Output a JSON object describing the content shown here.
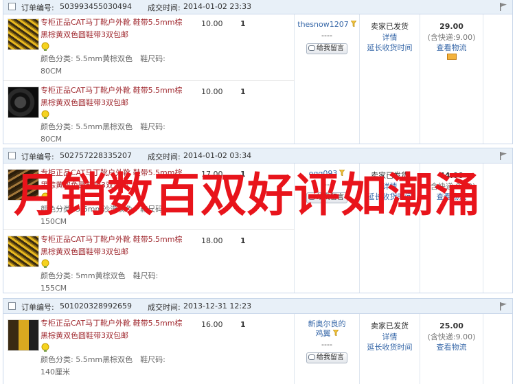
{
  "orders": [
    {
      "id_label": "订单编号:",
      "id": "503993455030494",
      "time_label": "成交时间:",
      "time": "2014-01-02 23:33",
      "items": [
        {
          "title": "专柜正品CAT马丁靴户外靴 鞋带5.5mm棕黑棕黄双色圆鞋带3双包邮",
          "attr": "颜色分类: 5.5mm黄棕双色　鞋尺码: 80CM",
          "price": "10.00",
          "qty": "1",
          "thumb": "rope-gold"
        },
        {
          "title": "专柜正品CAT马丁靴户外靴 鞋带5.5mm棕黑棕黄双色圆鞋带3双包邮",
          "attr": "颜色分类: 5.5mm黑棕双色　鞋尺码: 80CM",
          "price": "10.00",
          "qty": "1",
          "thumb": "rope-black"
        }
      ],
      "buyer": "thesnow1207",
      "buyer_dash": "----",
      "msg_button": "给我留言",
      "status": "卖家已发货",
      "details": "详情",
      "extend": "延长收货时间",
      "total": "29.00",
      "shipping": "(含快递:9.00)",
      "logistics": "查看物流"
    },
    {
      "id_label": "订单编号:",
      "id": "502757228335207",
      "time_label": "成交时间:",
      "time": "2014-01-02 03:34",
      "items": [
        {
          "title": "专柜正品CAT马丁靴户外靴 鞋带5.5mm棕黑棕黄双色圆鞋带3双包邮",
          "attr": "颜色分类: 5.5mm沙漠灰色　鞋尺码: 150CM",
          "price": "17.00",
          "qty": "1",
          "thumb": "rope-dark"
        },
        {
          "title": "专柜正品CAT马丁靴户外靴 鞋带5.5mm棕黑棕黄双色圆鞋带3双包邮",
          "attr": "颜色分类: 5mm黄棕双色　鞋尺码: 155CM",
          "price": "18.00",
          "qty": "1",
          "thumb": "rope-gold"
        }
      ],
      "buyer": "oqq093",
      "buyer_dash": "----",
      "msg_button": "给我留言",
      "status": "卖家已发货",
      "details": "详情",
      "extend": "延长收货时间",
      "total": "44.00",
      "shipping": "(含快递:9.00)",
      "logistics": "查看物流"
    },
    {
      "id_label": "订单编号:",
      "id": "501020328992659",
      "time_label": "成交时间:",
      "time": "2013-12-31 12:23",
      "items": [
        {
          "title": "专柜正品CAT马丁靴户外靴 鞋带5.5mm棕黑棕黄双色圆鞋带3双包邮",
          "attr": "颜色分类: 5.5mm黑棕双色　鞋尺码: 140厘米",
          "price": "16.00",
          "qty": "1",
          "thumb": "rope-multi"
        }
      ],
      "buyer": "新奥尔良的鸡翼",
      "buyer_dash": "----",
      "msg_button": "给我留言",
      "status": "卖家已发货",
      "details": "详情",
      "extend": "延长收货时间",
      "total": "25.00",
      "shipping": "(含快递:9.00)",
      "logistics": "查看物流"
    }
  ],
  "watermark": "月销数百双好评如潮涌",
  "colors": {
    "header_bg": "#e8f0f8",
    "link": "#3667a8",
    "item_title": "#a0292f",
    "watermark": "#e8141b"
  }
}
